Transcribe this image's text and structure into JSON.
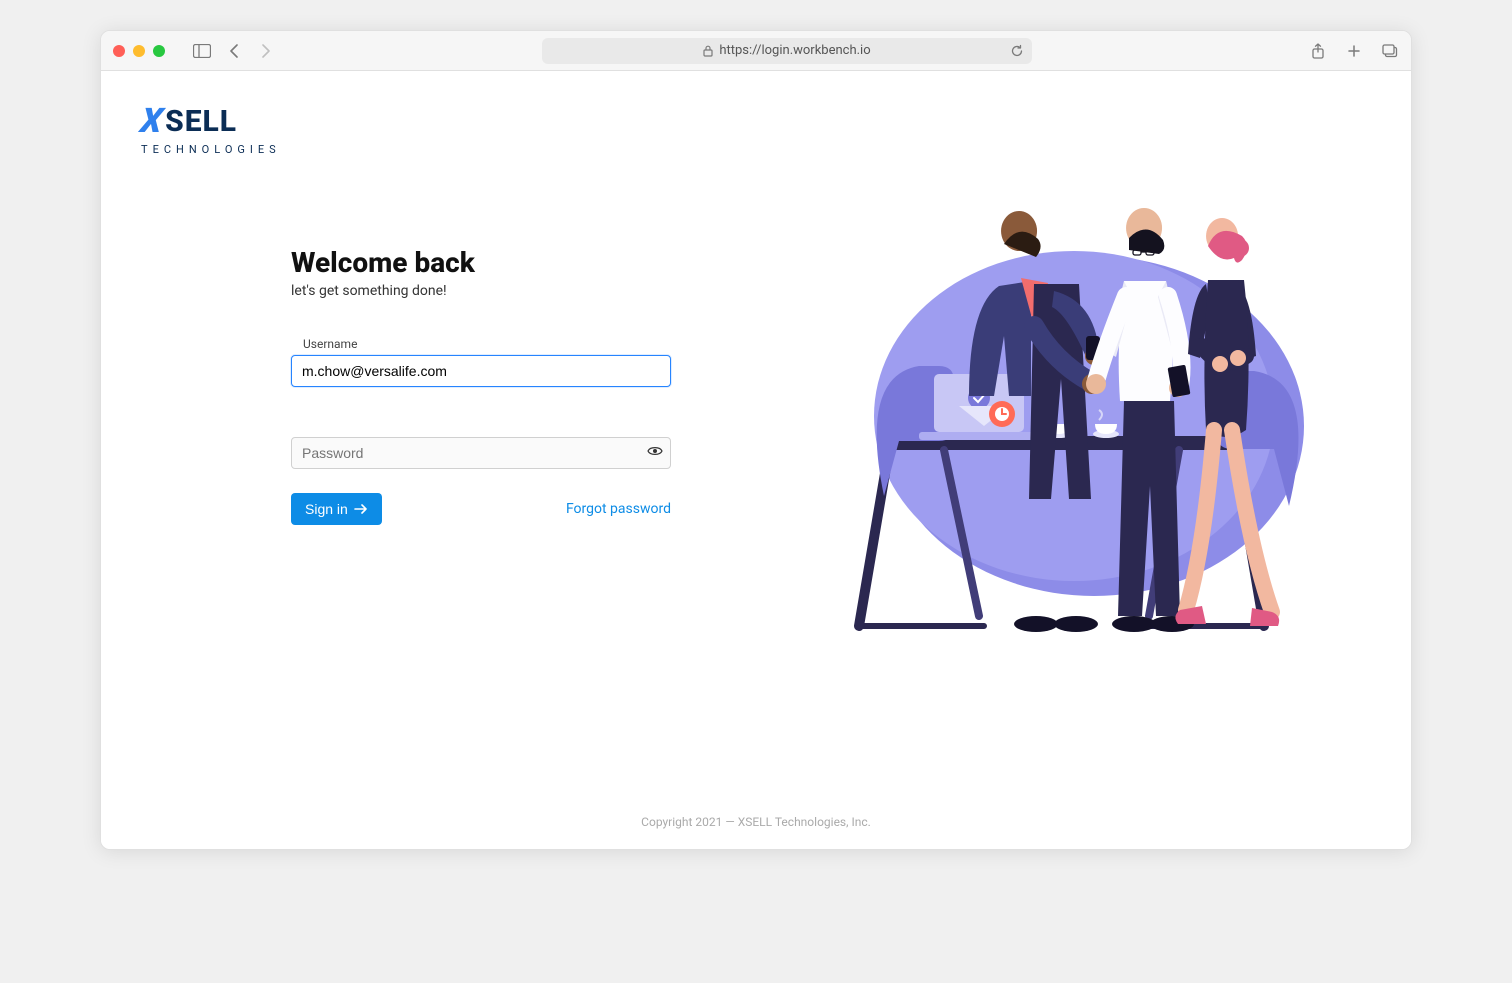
{
  "browser": {
    "url_display": "https://login.workbench.io"
  },
  "logo": {
    "main": "SELL",
    "x": "X",
    "sub": "TECHNOLOGIES"
  },
  "login": {
    "heading": "Welcome back",
    "subtitle": "let's get something done!",
    "username_label": "Username",
    "username_value": "m.chow@versalife.com",
    "password_placeholder": "Password",
    "password_value": "",
    "signin_label": "Sign in",
    "forgot_label": "Forgot password"
  },
  "footer": {
    "copyright": "Copyright 2021 — XSELL Technologies, Inc."
  }
}
